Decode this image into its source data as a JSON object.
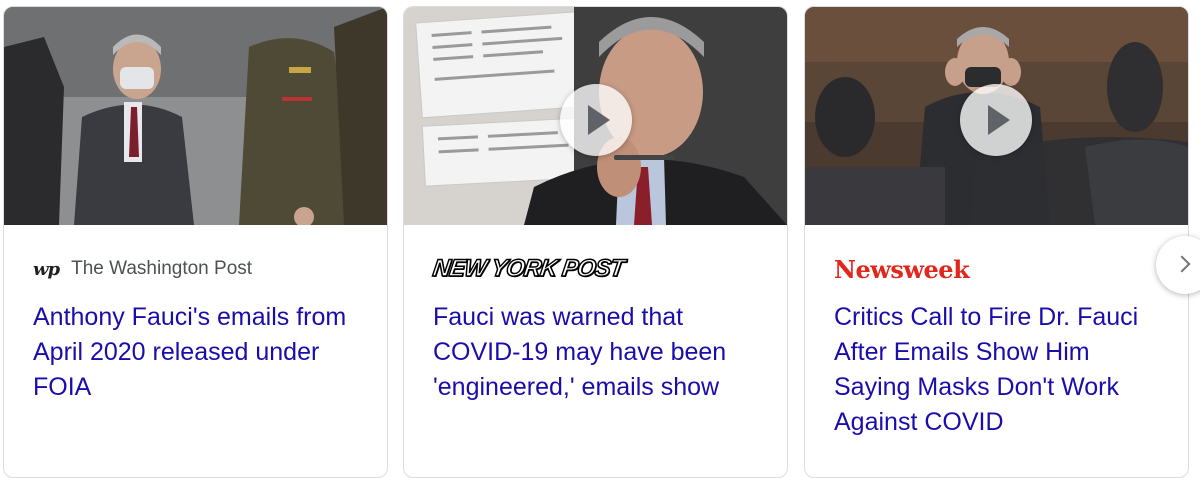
{
  "carousel": {
    "cards": [
      {
        "source": "The Washington Post",
        "source_logo": "wp",
        "headline": "Anthony Fauci's emails from April 2020 released under FOIA",
        "has_video": false,
        "image": "photo-fauci-masked-standing"
      },
      {
        "source": "New York Post",
        "source_logo": "NEW YORK POST",
        "headline": "Fauci was warned that COVID-19 may have been 'engineered,' emails show",
        "has_video": true,
        "image": "photo-fauci-emails-overlay"
      },
      {
        "source": "Newsweek",
        "source_logo": "Newsweek",
        "headline": "Critics Call to Fire Dr. Fauci After Emails Show Him Saying Masks Don't Work Against COVID",
        "has_video": true,
        "image": "photo-fauci-removing-mask"
      }
    ],
    "next_icon": "chevron-right-icon"
  },
  "colors": {
    "headline_link": "#1a0dab",
    "source_text": "#4d5156",
    "newsweek_red": "#e1261c",
    "card_border": "#dadce0"
  }
}
